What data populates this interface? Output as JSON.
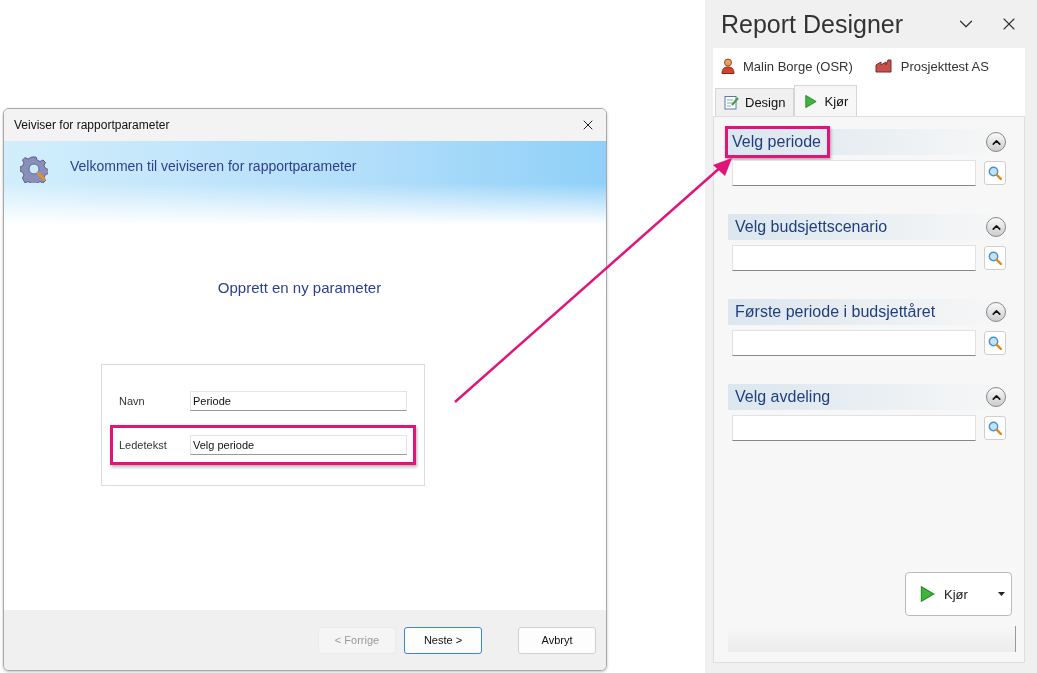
{
  "dialog": {
    "title": "Veiviser for rapportparameter",
    "banner": "Velkommen til veiviseren for rapportparameter",
    "heading": "Opprett en ny parameter",
    "fields": [
      {
        "label": "Navn",
        "value": "Periode",
        "highlighted": false
      },
      {
        "label": "Ledetekst",
        "value": "Velg periode",
        "highlighted": true
      }
    ],
    "buttons": [
      {
        "label": "< Forrige",
        "disabled": true,
        "focused": false
      },
      {
        "label": "Neste >",
        "disabled": false,
        "focused": true
      },
      {
        "label": "Avbryt",
        "disabled": false,
        "focused": false
      }
    ]
  },
  "panel": {
    "title": "Report Designer",
    "user": "Malin Borge (OSR)",
    "company": "Prosjekttest AS",
    "tabs": [
      {
        "label": "Design",
        "selected": false
      },
      {
        "label": "Kjør",
        "selected": true
      }
    ],
    "sections": [
      {
        "title": "Velg periode",
        "highlighted": true
      },
      {
        "title": "Velg budsjettscenario",
        "highlighted": false
      },
      {
        "title": "Første periode i budsjettåret",
        "highlighted": false
      },
      {
        "title": "Velg avdeling",
        "highlighted": false
      }
    ],
    "run_button": "Kjør"
  }
}
